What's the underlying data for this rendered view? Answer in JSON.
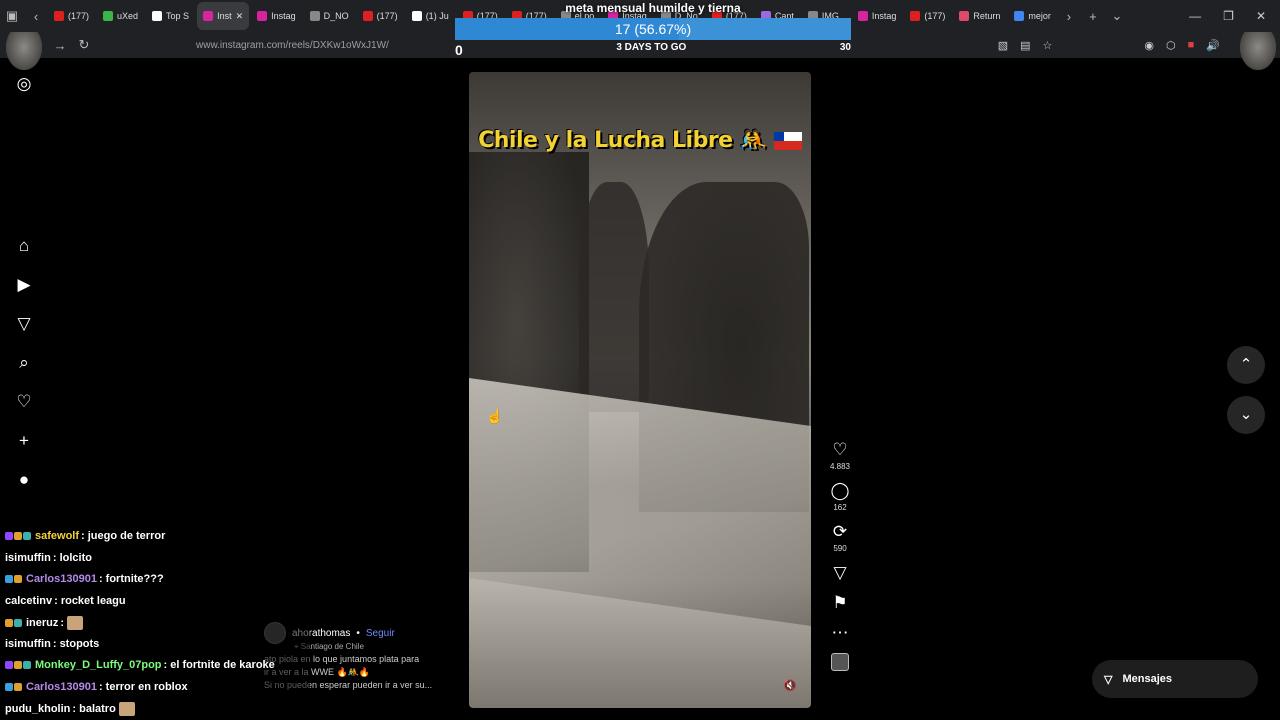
{
  "browser": {
    "tabs": [
      {
        "label": "(177)",
        "color": "#e02020"
      },
      {
        "label": "uXed",
        "color": "#39b54a"
      },
      {
        "label": "Top S",
        "color": "#ffffff"
      },
      {
        "label": "Inst",
        "color": "#d6249f",
        "active": true
      },
      {
        "label": "Instag",
        "color": "#d6249f"
      },
      {
        "label": "D_NO",
        "color": "#888888"
      },
      {
        "label": "(177)",
        "color": "#e02020"
      },
      {
        "label": "(1) Ju",
        "color": "#ffffff"
      },
      {
        "label": "(177)",
        "color": "#e02020"
      },
      {
        "label": "(177)",
        "color": "#e02020"
      },
      {
        "label": "el po",
        "color": "#888888"
      },
      {
        "label": "Instag",
        "color": "#d6249f"
      },
      {
        "label": "D_No",
        "color": "#888888"
      },
      {
        "label": "(177)",
        "color": "#e02020"
      },
      {
        "label": "Cant",
        "color": "#9c6ade"
      },
      {
        "label": "IMG_",
        "color": "#888888"
      },
      {
        "label": "Instag",
        "color": "#d6249f"
      },
      {
        "label": "(177)",
        "color": "#e02020"
      },
      {
        "label": "Return",
        "color": "#e04a6a"
      },
      {
        "label": "mejor",
        "color": "#4285f4"
      }
    ],
    "url": "www.instagram.com/reels/DXKw1oWxJ1W/"
  },
  "goal": {
    "title": "meta mensual humilde y tierna",
    "progress_text": "17 (56.67%)",
    "progress_fraction": 0.5667,
    "start": "0",
    "countdown": "3 DAYS TO GO",
    "target": "30"
  },
  "reel": {
    "title_text": "Chile y la Lucha Libre",
    "likes": "4.883",
    "comments": "162",
    "reposts": "590"
  },
  "caption": {
    "user": "ahorathomas",
    "follow": "Seguir",
    "location": "Santiago de Chile",
    "line1": "ato piola en lo que juntamos plata para",
    "line2": "ir a ver a la WWE",
    "line3": "Si no pueden esperar pueden ir a ver su..."
  },
  "messages_label": "Mensajes",
  "chat": [
    {
      "user": "safewolf",
      "color": "#f5d33a",
      "msg": ": juego de terror",
      "badges": [
        "#9146ff",
        "#e0a030",
        "#3ab0b0"
      ]
    },
    {
      "user": "isimuffin",
      "color": "#ffffff",
      "msg": ": lolcito",
      "badges": []
    },
    {
      "user": "Carlos130901",
      "color": "#b48ae8",
      "msg": ": fortnite???",
      "badges": [
        "#3aa0e0",
        "#e0a030"
      ]
    },
    {
      "user": "calcetinv",
      "color": "#ffffff",
      "msg": ": rocket leagu",
      "badges": []
    },
    {
      "user": "ineruz",
      "color": "#ffffff",
      "msg": ":",
      "badges": [
        "#e0a030",
        "#3ab0b0"
      ],
      "emote": true
    },
    {
      "user": "isimuffin",
      "color": "#ffffff",
      "msg": ": stopots",
      "badges": []
    },
    {
      "user": "Monkey_D_Luffy_07pop",
      "color": "#7cfc7c",
      "msg": ": el fortnite de karoke",
      "badges": [
        "#9146ff",
        "#e0a030",
        "#3ab0b0"
      ]
    },
    {
      "user": "Carlos130901",
      "color": "#b48ae8",
      "msg": ": terror en roblox",
      "badges": [
        "#3aa0e0",
        "#e0a030"
      ]
    },
    {
      "user": "pudu_kholin",
      "color": "#ffffff",
      "msg": ": balatro",
      "badges": [],
      "emote": true
    }
  ]
}
